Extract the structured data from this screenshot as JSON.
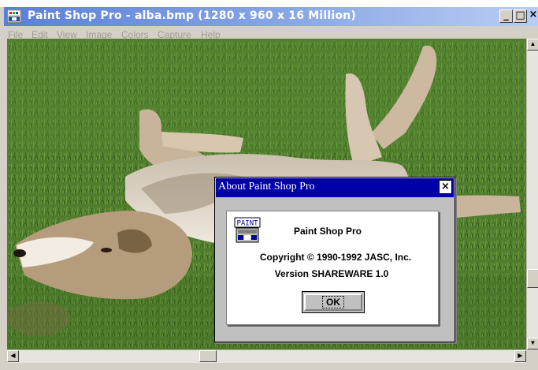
{
  "window": {
    "title": "Paint Shop Pro - alba.bmp (1280 x 960 x 16 Million)",
    "minimize_label": "_",
    "maximize_label": "□",
    "close_label": "×"
  },
  "menu": {
    "items": [
      "File",
      "Edit",
      "View",
      "Image",
      "Colors",
      "Capture",
      "Help"
    ]
  },
  "canvas": {
    "image_icon": "photo-wolf-lying-on-grass"
  },
  "dialog": {
    "title": "About Paint Shop Pro",
    "close_label": "×",
    "icon_text": "PAINT",
    "product": "Paint Shop Pro",
    "copyright": "Copyright © 1990-1992 JASC, Inc.",
    "version": "Version SHAREWARE 1.0",
    "ok_label": "OK"
  },
  "colors": {
    "title_gradient_start": "#5a7fd8",
    "dialog_title": "#0000a8",
    "grass": "#4d7a2c"
  }
}
